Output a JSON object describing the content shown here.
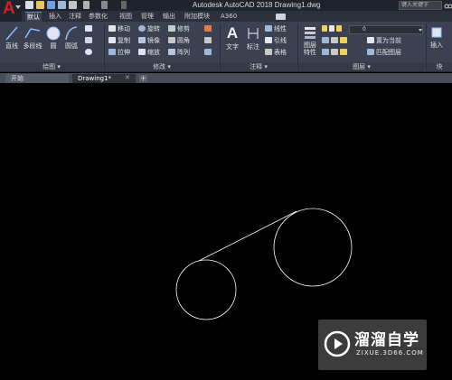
{
  "title_bar": {
    "window_title": "Autodesk AutoCAD 2018    Drawing1.dwg",
    "search_placeholder": "键入关键字"
  },
  "ribbon_tabs": [
    "默认",
    "插入",
    "注释",
    "参数化",
    "视图",
    "管理",
    "输出",
    "附加模块",
    "A360"
  ],
  "ribbon": {
    "draw": {
      "line": "直线",
      "polyline": "多段线",
      "circle": "圆",
      "arc": "圆弧",
      "title": "绘图"
    },
    "modify": {
      "move": "移动",
      "rotate": "旋转",
      "trim": "修剪",
      "copy": "复制",
      "mirror": "镜像",
      "fillet": "圆角",
      "stretch": "拉伸",
      "scale": "缩放",
      "array": "阵列",
      "title": "修改"
    },
    "annotation": {
      "text": "文字",
      "dimension": "标注",
      "linear": "线性",
      "leader": "引线",
      "table": "表格",
      "title": "注释"
    },
    "layers": {
      "layer_properties": "图层\n特性",
      "current_layer": "0",
      "set_current": "置为当前",
      "match_layer": "匹配图层",
      "title": "图层"
    },
    "insert": {
      "insert": "插入",
      "block_title": "块"
    }
  },
  "doc_tabs": {
    "start": "开始",
    "drawing": "Drawing1*",
    "close": "✕",
    "add": "+"
  },
  "watermark": {
    "title": "溜溜自学",
    "url": "ZIXUE.3D66.COM"
  },
  "colors": {
    "canvas": "#000000",
    "ribbon": "#3b4150",
    "titlebar": "#1e232c",
    "logo_red": "#d0202a",
    "geometry": "#ffffff"
  }
}
